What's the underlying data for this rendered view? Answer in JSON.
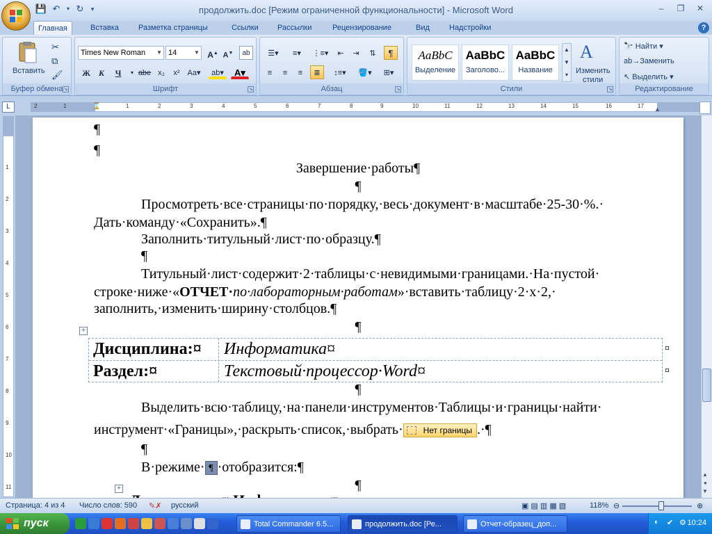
{
  "window": {
    "title": "продолжить.doc [Режим ограниченной функциональности] - Microsoft Word"
  },
  "tabs": [
    "Главная",
    "Вставка",
    "Разметка страницы",
    "Ссылки",
    "Рассылки",
    "Рецензирование",
    "Вид",
    "Надстройки"
  ],
  "ribbon": {
    "clipboard": {
      "paste_label": "Вставить",
      "group_label": "Буфер обмена"
    },
    "font": {
      "family": "Times New Roman",
      "size": "14",
      "group_label": "Шрифт",
      "bold": "Ж",
      "italic": "К",
      "underline": "Ч",
      "strike": "abe"
    },
    "paragraph": {
      "group_label": "Абзац"
    },
    "styles": {
      "group_label": "Стили",
      "items": [
        {
          "sample": "AaBbC",
          "name": "Выделение"
        },
        {
          "sample": "AaBbC",
          "name": "Заголово..."
        },
        {
          "sample": "AaBbC",
          "name": "Название"
        }
      ],
      "change_label": "Изменить",
      "change_label2": "стили"
    },
    "editing": {
      "find": "Найти",
      "replace": "Заменить",
      "select": "Выделить",
      "group_label": "Редактирование"
    }
  },
  "ruler": {
    "numbers": [
      "2",
      "1",
      "1",
      "2",
      "3",
      "4",
      "5",
      "6",
      "7",
      "8",
      "9",
      "10",
      "11",
      "12",
      "13",
      "14",
      "15",
      "16",
      "17"
    ],
    "vnumbers": [
      "1",
      "2",
      "3",
      "4",
      "5",
      "6",
      "7",
      "8",
      "9",
      "10",
      "11"
    ]
  },
  "document": {
    "heading": "Завершение·работы¶",
    "p1a": "Просмотреть·все·страницы·по·порядку,·весь·документ·в·масштабе·25-30·%.·",
    "p1b": "Дать·команду·«Сохранить».¶",
    "p2": "Заполнить·титульный·лист·по·образцу.¶",
    "p3a": "Титульный·лист·содержит·2·таблицы·с·невидимыми·границами.·На·пустой·",
    "p3b_pre": "строке·ниже·«",
    "p3b_bold": "ОТЧЕТ·",
    "p3b_ital": "по·лабораторным·работам",
    "p3b_post": "»·вставить·таблицу·2·x·2,·",
    "p3c": "заполнить,·изменить·ширину·столбцов.¶",
    "table": [
      [
        "Дисциплина:¤",
        "Информатика¤"
      ],
      [
        "Раздел:¤",
        "Текстовый·процессор·Word¤"
      ]
    ],
    "p4a": "Выделить·всю·таблицу,·на·панели·инструментов·Таблицы·и·границы·найти·",
    "p4b_pre": "инструмент·«Границы»,·раскрыть·список,·выбрать·",
    "p4b_chip": "Нет границы",
    "p4b_post": ".·¶",
    "p5_pre": "В·режиме·",
    "p5_btn": "¶",
    "p5_post": "·отобразится:¶",
    "pilcrow": "¶",
    "cell_end": "¤",
    "partial_last": "Дисциплина:¤ Информатика¤"
  },
  "status": {
    "page": "Страница: 4 из 4",
    "words": "Число слов: 590",
    "lang": "русский",
    "zoom": "118%"
  },
  "taskbar": {
    "start": "пуск",
    "tasks": [
      "Total Commander 6.5...",
      "продолжить.doc [Ре...",
      "Отчет-образец_доп..."
    ],
    "clock": "10:24"
  },
  "colors": {
    "ribbon_bg": "#c4d7ef",
    "taskbar": "#245edb",
    "start": "#3c963c"
  }
}
